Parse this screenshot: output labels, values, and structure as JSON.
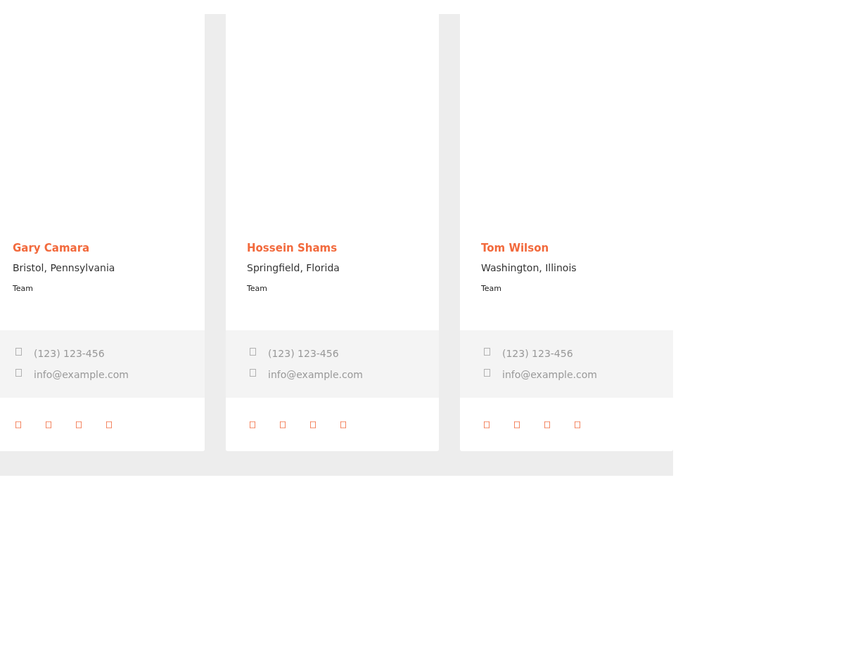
{
  "cards": [
    {
      "name": "Gary Camara",
      "location": "Bristol, Pennsylvania",
      "role": "Team",
      "phone": "(123) 123-456",
      "email": "info@example.com"
    },
    {
      "name": "Hossein Shams",
      "location": "Springfield, Florida",
      "role": "Team",
      "phone": "(123) 123-456",
      "email": "info@example.com"
    },
    {
      "name": "Tom Wilson",
      "location": "Washington, Illinois",
      "role": "Team",
      "phone": "(123) 123-456",
      "email": "info@example.com"
    }
  ]
}
